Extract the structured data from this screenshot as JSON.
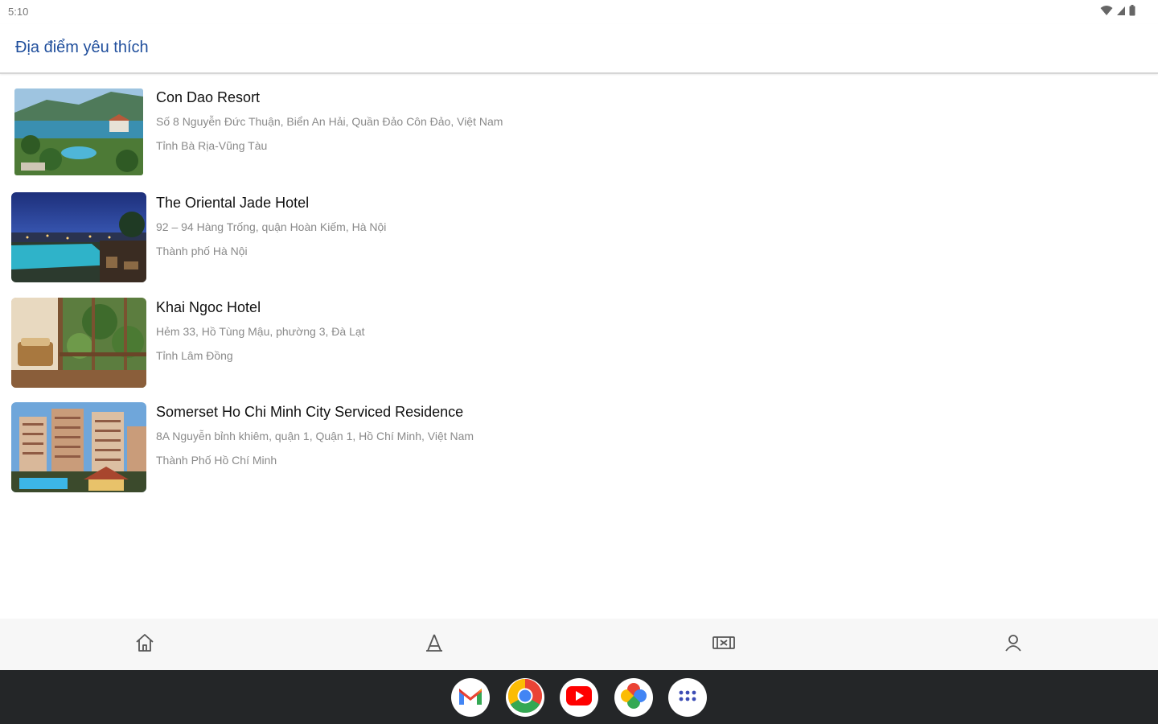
{
  "status": {
    "time": "5:10"
  },
  "header": {
    "title": "Địa điểm yêu thích"
  },
  "places": [
    {
      "name": "Con Dao Resort",
      "address": "Số 8 Nguyễn Đức Thuận, Biển An Hải, Quần Đảo Côn Đảo, Việt Nam",
      "province": "Tỉnh Bà Rịa-Vũng Tàu"
    },
    {
      "name": "The Oriental Jade Hotel",
      "address": "92 – 94 Hàng Trống, quận Hoàn Kiếm, Hà Nội",
      "province": "Thành phố Hà Nội"
    },
    {
      "name": "Khai Ngoc Hotel",
      "address": "Hẻm 33, Hồ Tùng Mậu, phường 3, Đà Lạt",
      "province": "Tỉnh Lâm Đồng"
    },
    {
      "name": "Somerset Ho Chi Minh City Serviced Residence",
      "address": "8A Nguyễn bỉnh khiêm, quận 1, Quận 1, Hồ Chí Minh, Việt Nam",
      "province": "Thành Phố Hồ Chí Minh"
    }
  ],
  "nav": {
    "icons": [
      "home-icon",
      "place-icon",
      "ticket-icon",
      "person-icon"
    ]
  },
  "dock": {
    "apps": [
      "gmail-icon",
      "chrome-icon",
      "youtube-icon",
      "photos-icon",
      "app-drawer-icon"
    ]
  },
  "colors": {
    "title": "#1f4e9c",
    "taskbar": "#242628",
    "nav_bg": "#f7f7f7"
  }
}
